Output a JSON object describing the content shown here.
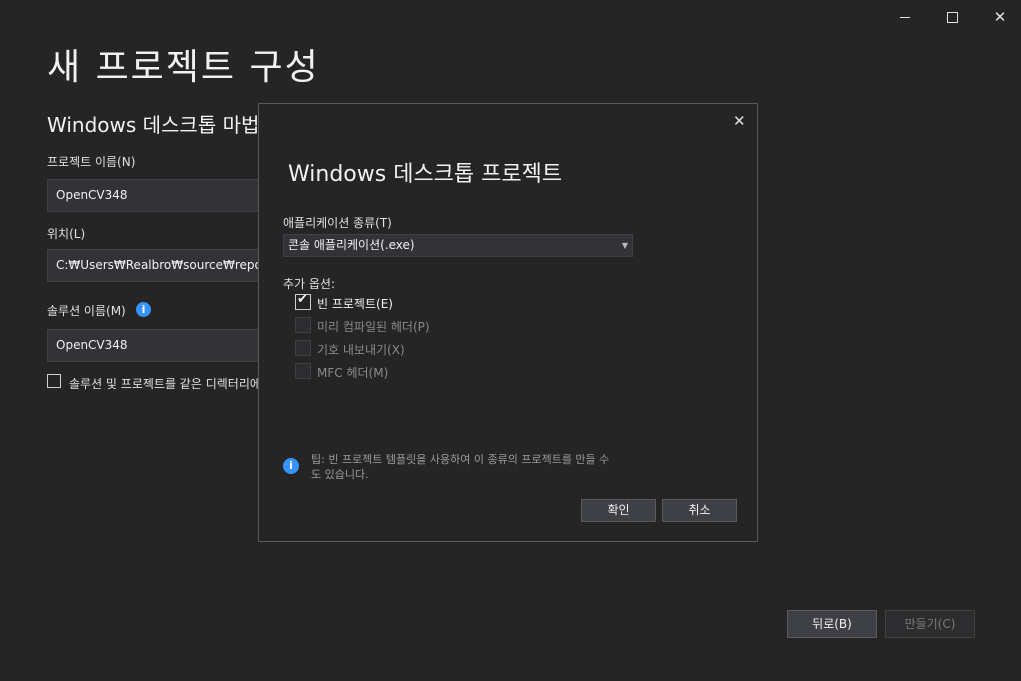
{
  "window": {
    "controls": {
      "minimize": "minimize",
      "maximize": "maximize",
      "close": "close"
    }
  },
  "main": {
    "page_title": "새 프로젝트 구성",
    "section_title": "Windows 데스크톱 마법사",
    "project_name_label": "프로젝트 이름(N)",
    "project_name_value": "OpenCV348",
    "location_label": "위치(L)",
    "location_value": "C:₩Users₩Realbro₩source₩repos",
    "solution_name_label": "솔루션 이름(M)",
    "solution_name_value": "OpenCV348",
    "info_glyph": "i",
    "same_dir_label": "솔루션 및 프로젝트를 같은 디렉터리에 배치(D)",
    "same_dir_checked": false
  },
  "footer": {
    "back_label": "뒤로(B)",
    "create_label": "만들기(C)"
  },
  "dialog": {
    "title": "Windows 데스크톱 프로젝트",
    "app_type_label": "애플리케이션 종류(T)",
    "app_type_value": "콘솔 애플리케이션(.exe)",
    "options_label": "추가 옵션:",
    "options": [
      {
        "label": "빈 프로젝트(E)",
        "checked": true,
        "enabled": true
      },
      {
        "label": "미리 컴파일된 헤더(P)",
        "checked": false,
        "enabled": false
      },
      {
        "label": "기호 내보내기(X)",
        "checked": false,
        "enabled": false
      },
      {
        "label": "MFC 헤더(M)",
        "checked": false,
        "enabled": false
      }
    ],
    "tip_glyph": "i",
    "tip_text": "팁: 빈 프로젝트 템플릿을 사용하여 이 종류의 프로젝트를 만들 수도 있습니다.",
    "ok_label": "확인",
    "cancel_label": "취소",
    "close_glyph": "✕"
  },
  "colors": {
    "background": "#252526",
    "accent_info": "#3794ff",
    "disabled_text": "#8a8a8a"
  }
}
